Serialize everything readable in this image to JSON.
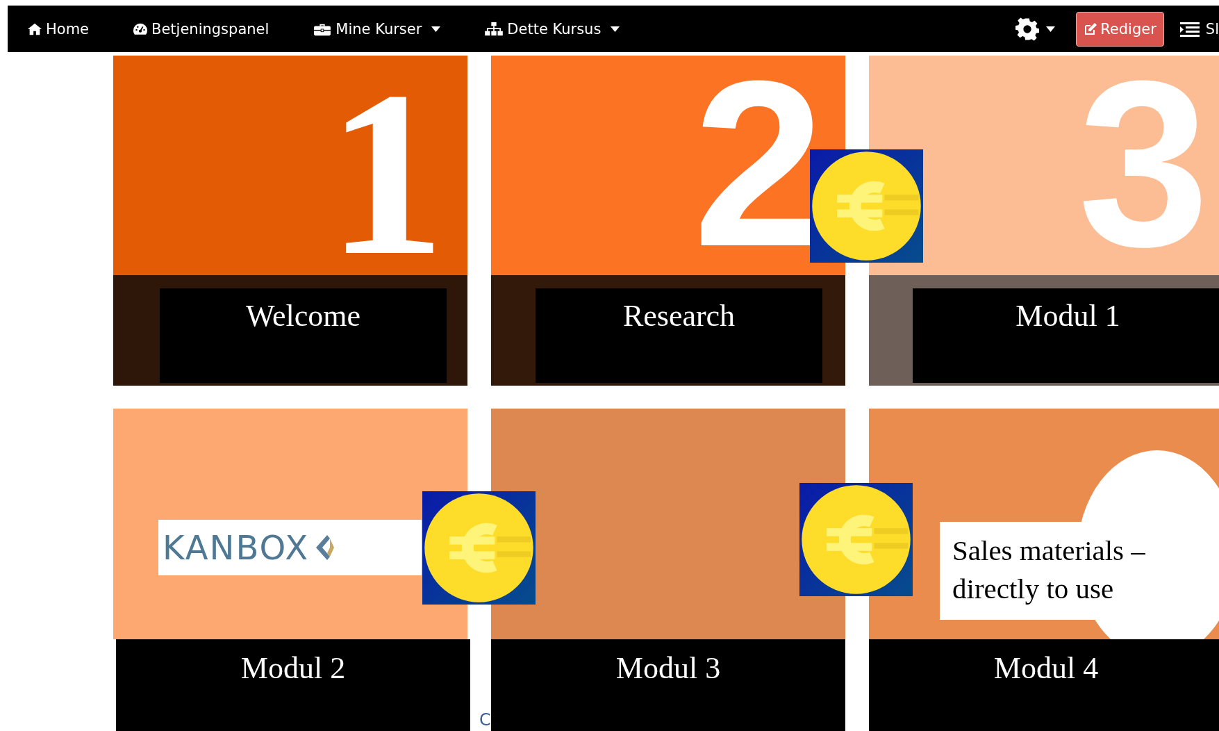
{
  "navbar": {
    "items": [
      {
        "label": "Home",
        "dropdown": false
      },
      {
        "label": "Betjeningspanel",
        "dropdown": false
      },
      {
        "label": "Mine Kurser",
        "dropdown": true
      },
      {
        "label": "Dette Kursus",
        "dropdown": true
      }
    ],
    "settings_dropdown": true,
    "edit_button": "Rediger",
    "cut_item": "Sl"
  },
  "tiles": [
    {
      "number": "1",
      "color": "#e35b04",
      "caption": "Welcome"
    },
    {
      "number": "2",
      "color": "#fc7324",
      "caption": "Research",
      "overlays": [
        {
          "kind": "coin"
        }
      ]
    },
    {
      "number": "3",
      "color": "#fdbd94",
      "caption": "Modul 1"
    },
    {
      "color": "#fda870",
      "caption": "Modul 2",
      "overlays": [
        {
          "kind": "logo",
          "text": "KANBOX"
        },
        {
          "kind": "coin"
        }
      ]
    },
    {
      "color": "#dd8850",
      "caption": "Modul 3",
      "overlays": [
        {
          "kind": "coin"
        }
      ]
    },
    {
      "color": "#e98c4e",
      "caption": "Modul 4",
      "overlays": [
        {
          "kind": "note",
          "text": "Sales materials –\ndirectly to use"
        }
      ]
    }
  ],
  "stray_text": "C"
}
